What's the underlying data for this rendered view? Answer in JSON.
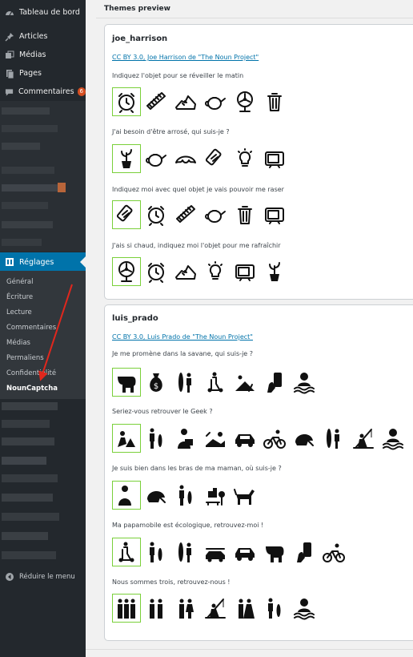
{
  "sidebar": {
    "top_items": [
      {
        "label": "Tableau de bord",
        "icon": "dashboard-icon"
      },
      {
        "label": "Articles",
        "icon": "pin-icon"
      },
      {
        "label": "Médias",
        "icon": "media-icon"
      },
      {
        "label": "Pages",
        "icon": "page-icon"
      },
      {
        "label": "Commentaires",
        "icon": "comment-icon",
        "badge": "6"
      }
    ],
    "active_item": {
      "label": "Réglages",
      "icon": "settings-icon"
    },
    "submenu": [
      {
        "label": "Général"
      },
      {
        "label": "Écriture"
      },
      {
        "label": "Lecture"
      },
      {
        "label": "Commentaires"
      },
      {
        "label": "Médias"
      },
      {
        "label": "Permaliens"
      },
      {
        "label": "Confidentialité"
      },
      {
        "label": "NounCaptcha",
        "current": true
      }
    ],
    "collapse": {
      "label": "Réduire le menu",
      "icon": "collapse-icon"
    },
    "colors": {
      "bg": "#23282d",
      "active": "#0073aa",
      "badge": "#d54e21",
      "annotation_arrow": "#e0271d"
    }
  },
  "main": {
    "title": "Themes preview",
    "themes": [
      {
        "name": "joe_harrison",
        "credit": "CC BY 3.0, Joe Harrison de \"The Noun Project\"",
        "questions": [
          {
            "text": "Indiquez l'objet pour se réveiller le matin",
            "icons": [
              "alarm-clock-icon",
              "comb-icon",
              "sneaker-icon",
              "teapot-icon",
              "fan-icon",
              "trash-can-icon"
            ]
          },
          {
            "text": "J'ai besoin d'être arrosé, qui suis-je ?",
            "icons": [
              "potted-plant-icon",
              "teapot-icon",
              "croissant-icon",
              "razor-icon",
              "lightbulb-icon",
              "television-icon"
            ]
          },
          {
            "text": "Indiquez moi avec quel objet je vais pouvoir me raser",
            "icons": [
              "razor-icon",
              "alarm-clock-icon",
              "comb-icon",
              "teapot-icon",
              "trash-can-icon",
              "television-icon"
            ]
          },
          {
            "text": "J'ais si chaud, indiquez moi l'objet pour me rafraîchir",
            "icons": [
              "fan-icon",
              "alarm-clock-icon",
              "sneaker-icon",
              "lightbulb-icon",
              "television-icon",
              "potted-plant-icon"
            ]
          }
        ]
      },
      {
        "name": "luis_prado",
        "credit": "CC BY 3.0, Luis Prado de \"The Noun Project\"",
        "questions": [
          {
            "text": "Je me promène dans la savane, qui suis-je ?",
            "icons": [
              "elephant-icon",
              "money-bag-icon",
              "surfer-icon",
              "scooter-icon",
              "camper-icon",
              "phone-hand-icon",
              "swimmer-icon"
            ]
          },
          {
            "text": "Seriez-vous retrouver le Geek ?",
            "icons": [
              "geek-laptop-icon",
              "man-fish-icon",
              "reader-icon",
              "relax-icon",
              "car-icon",
              "cyclist-icon",
              "helmet-icon",
              "surfer-icon",
              "fisherman-icon",
              "swimmer-icon"
            ]
          },
          {
            "text": "Je suis bien dans les bras de ma maman, où suis-je ?",
            "icons": [
              "mother-child-icon",
              "helmet-icon",
              "man-fish-icon",
              "city-park-icon",
              "dog-walk-icon"
            ]
          },
          {
            "text": "Ma papamobile est écologique, retrouvez-moi !",
            "icons": [
              "scooter-icon",
              "man-fish-icon",
              "surfer-icon",
              "kayak-car-icon",
              "car-icon",
              "elephant-icon",
              "phone-hand-icon",
              "cyclist-icon"
            ]
          },
          {
            "text": "Nous sommes trois, retrouvez-nous !",
            "icons": [
              "three-people-icon",
              "two-people-icon",
              "couple-icon",
              "fisherman-icon",
              "wedding-icon",
              "man-fish-icon",
              "swimmer-icon"
            ]
          }
        ]
      }
    ]
  }
}
